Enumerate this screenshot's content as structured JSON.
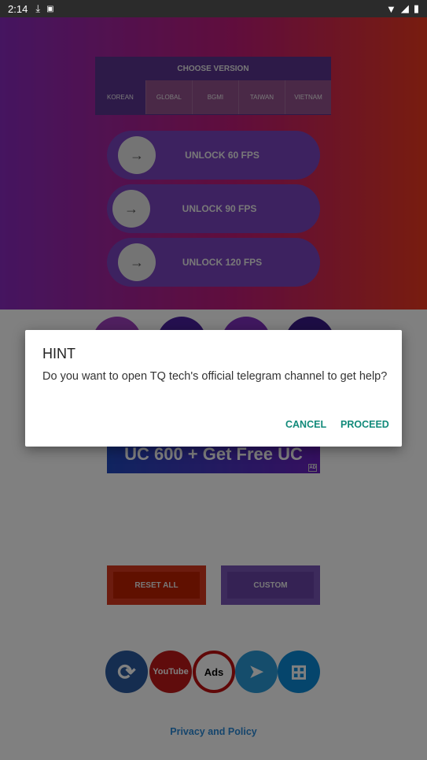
{
  "status_bar": {
    "time": "2:14"
  },
  "chooser": {
    "title": "CHOOSE VERSION",
    "tabs": [
      "KOREAN",
      "GLOBAL",
      "BGMI",
      "TAIWAN",
      "VIETNAM"
    ],
    "selected": "KOREAN"
  },
  "unlock": [
    "UNLOCK 60 FPS",
    "UNLOCK 90 FPS",
    "UNLOCK 120 FPS"
  ],
  "banner": {
    "text": "UC 600 + Get Free UC",
    "ad": "AD"
  },
  "actions": {
    "reset": "RESET ALL",
    "custom": "CUSTOM"
  },
  "icons": [
    "refresh-icon",
    "youtube-icon",
    "no-ads-icon",
    "telegram-icon",
    "more-apps-icon"
  ],
  "icon_labels": {
    "youtube": "YouTube",
    "ads": "Ads"
  },
  "privacy": "Privacy and Policy",
  "dialog": {
    "title": "HINT",
    "message": "Do you want to open TQ tech's official telegram channel to get help?",
    "cancel": "CANCEL",
    "proceed": "PROCEED"
  },
  "colors": {
    "accent": "#128a7a"
  }
}
